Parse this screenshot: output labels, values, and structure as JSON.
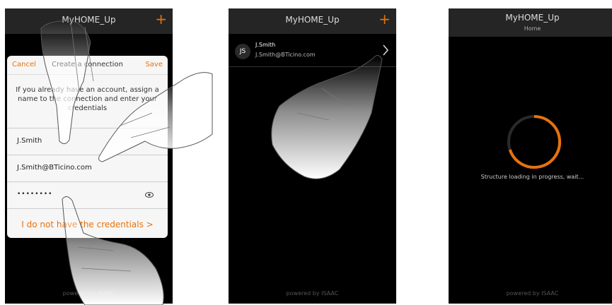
{
  "phone1": {
    "title": "MyHOME_Up",
    "add_icon": "+",
    "dialog": {
      "cancel": "Cancel",
      "title": "Create a connection",
      "save": "Save",
      "info": "If you already have an account, assign a name to the connection and enter your credentials",
      "name_value": "J.Smith",
      "email_value": "J.Smith@BTicino.com",
      "password_value": "••••••••",
      "no_credentials_link": "I do not have the credentials >"
    },
    "footer": "powered by ISAAC"
  },
  "phone2": {
    "title": "MyHOME_Up",
    "add_icon": "+",
    "user": {
      "initials": "JS",
      "name": "J.Smith",
      "email": "J.Smith@BTicino.com"
    },
    "footer": "powered by ISAAC"
  },
  "phone3": {
    "title": "MyHOME_Up",
    "subtitle": "Home",
    "status": "Structure loading in progress, wait...",
    "footer": "powered by ISAAC"
  },
  "colors": {
    "accent": "#e8720c",
    "background": "#000000",
    "header": "#252525"
  }
}
